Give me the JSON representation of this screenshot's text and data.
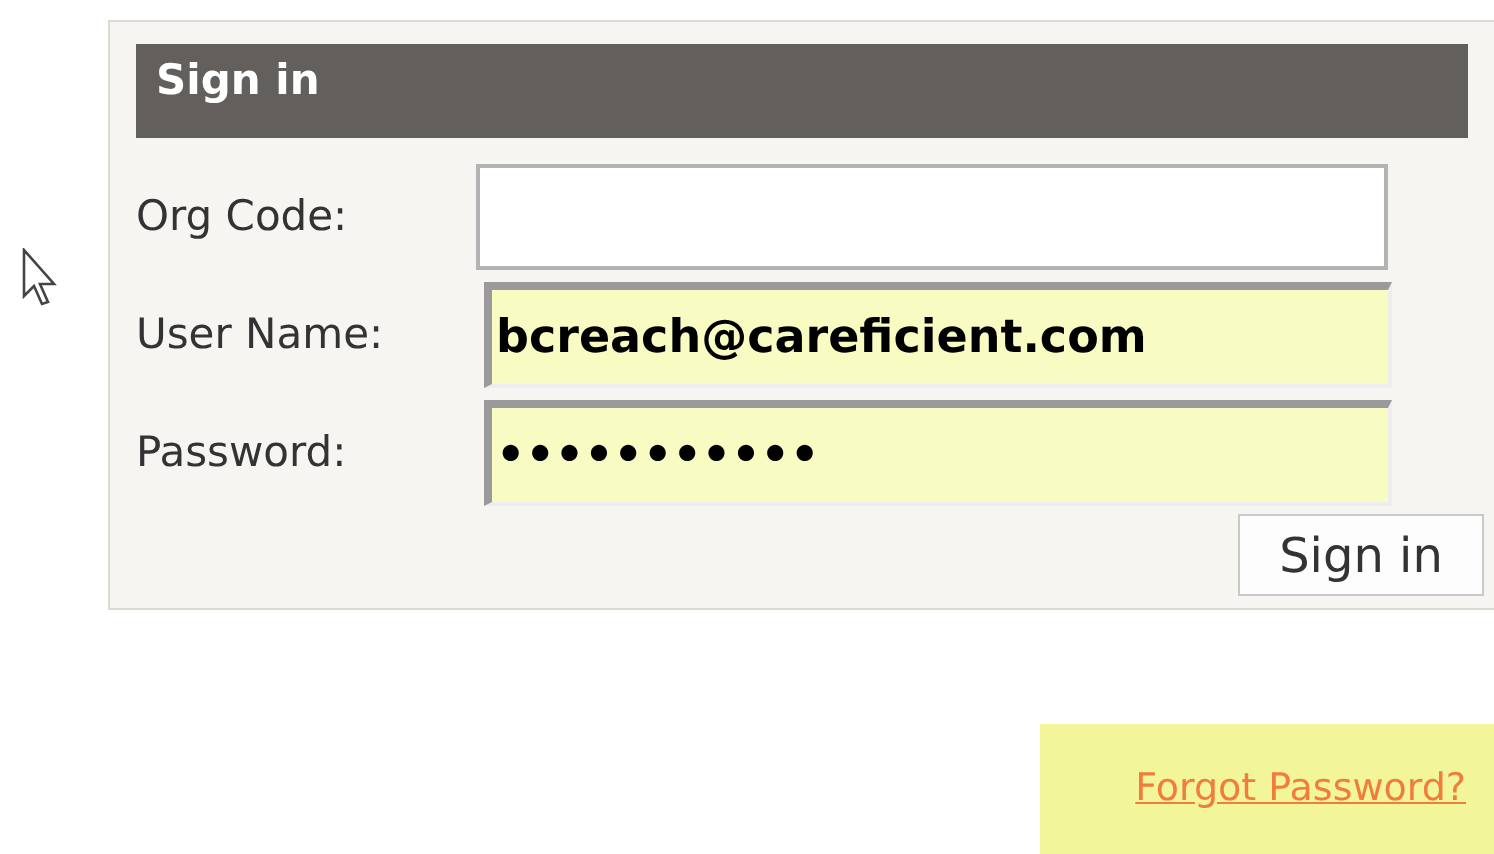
{
  "panel": {
    "title": "Sign in",
    "fields": [
      {
        "label": "Org Code:",
        "autofilled": false
      },
      {
        "label": "User Name:",
        "value": "bcreach@careficient.com",
        "autofilled": true
      },
      {
        "label": "Password:",
        "value": "•••••••••••",
        "autofilled": true
      }
    ],
    "submit": "Sign in"
  },
  "forgot_link": "Forgot Password?"
}
